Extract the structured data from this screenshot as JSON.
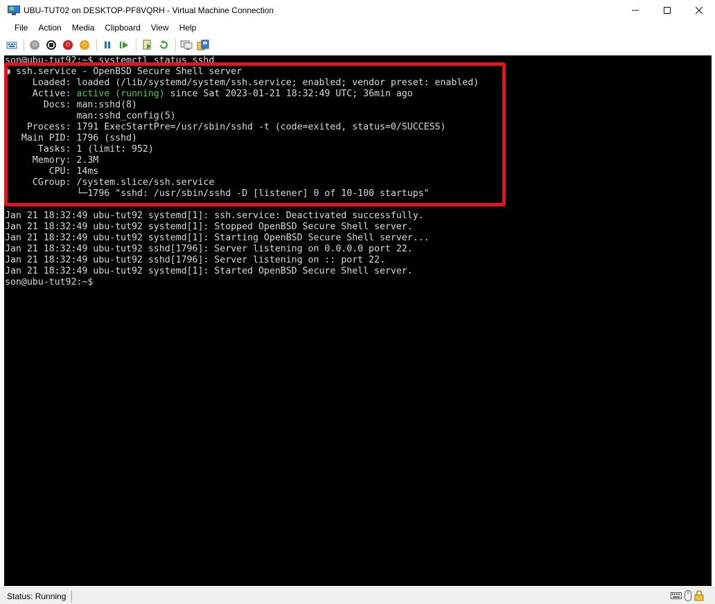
{
  "window": {
    "title": "UBU-TUT02 on DESKTOP-PF8VQRH - Virtual Machine Connection",
    "minimize_glyph": "—",
    "maximize_glyph": "☐",
    "close_glyph": "✕"
  },
  "menu": [
    "File",
    "Action",
    "Media",
    "Clipboard",
    "View",
    "Help"
  ],
  "toolbar": {
    "icons": [
      "ctrl-alt-del-icon",
      "start-icon",
      "turn-off-icon",
      "shutdown-icon",
      "save-icon",
      "pause-icon",
      "resume-icon",
      "checkpoint-icon",
      "revert-icon",
      "enhanced-session-icon",
      "share-icon"
    ]
  },
  "terminal": {
    "prompt_line": "son@ubu-tut92:~$ systemctl status sshd",
    "status_lines": [
      "● ssh.service - OpenBSD Secure Shell server",
      "     Loaded: loaded (/lib/systemd/system/ssh.service; enabled; vendor preset: enabled)",
      {
        "prefix": "     Active: ",
        "highlight": "active (running)",
        "suffix": " since Sat 2023-01-21 18:32:49 UTC; 36min ago"
      },
      "       Docs: man:sshd(8)",
      "             man:sshd_config(5)",
      "    Process: 1791 ExecStartPre=/usr/sbin/sshd -t (code=exited, status=0/SUCCESS)",
      "   Main PID: 1796 (sshd)",
      "      Tasks: 1 (limit: 952)",
      "     Memory: 2.3M",
      "        CPU: 14ms",
      "     CGroup: /system.slice/ssh.service",
      "             └─1796 \"sshd: /usr/sbin/sshd -D [listener] 0 of 10-100 startups\""
    ],
    "log_lines": [
      "Jan 21 18:32:49 ubu-tut92 systemd[1]: ssh.service: Deactivated successfully.",
      "Jan 21 18:32:49 ubu-tut92 systemd[1]: Stopped OpenBSD Secure Shell server.",
      "Jan 21 18:32:49 ubu-tut92 systemd[1]: Starting OpenBSD Secure Shell server...",
      "Jan 21 18:32:49 ubu-tut92 sshd[1796]: Server listening on 0.0.0.0 port 22.",
      "Jan 21 18:32:49 ubu-tut92 sshd[1796]: Server listening on :: port 22.",
      "Jan 21 18:32:49 ubu-tut92 systemd[1]: Started OpenBSD Secure Shell server."
    ],
    "final_prompt": "son@ubu-tut92:~$"
  },
  "status": {
    "text": "Status: Running",
    "icons": [
      "keyboard-icon",
      "mouse-icon",
      "lock-icon"
    ]
  },
  "colors": {
    "terminal_bg": "#000000",
    "terminal_fg": "#d8d8d8",
    "active_green": "#3ed13e",
    "highlight_red": "#e3141b"
  }
}
